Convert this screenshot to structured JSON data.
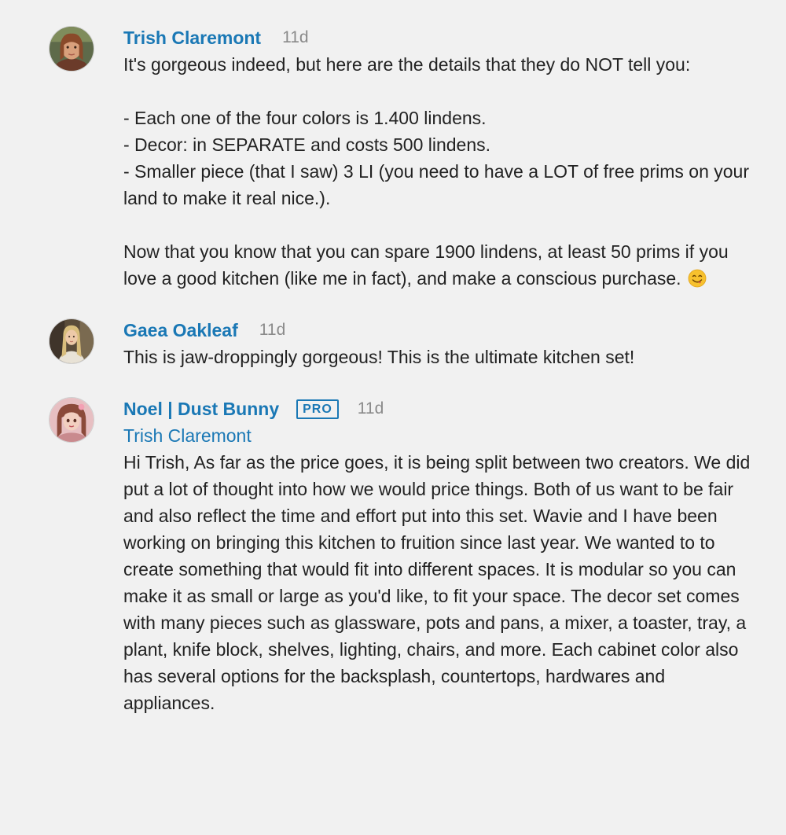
{
  "comments": [
    {
      "author": "Trish Claremont",
      "time": "11d",
      "avatar_icon": "avatar-trish-icon",
      "lines": {
        "p1": "It's gorgeous indeed, but here are the details that they do NOT tell you:",
        "b1": "- Each one of the four colors is 1.400 lindens.",
        "b2": "- Decor: in SEPARATE and costs 500 lindens.",
        "b3": "- Smaller piece (that I saw) 3 LI (you need to have a LOT of free prims on your land to make it real nice.).",
        "p2": "Now that you know that you can spare 1900 lindens, at least 50 prims if you love a good kitchen (like me in fact), and make a conscious purchase."
      },
      "emoji": "face-savoring-food-emoji"
    },
    {
      "author": "Gaea Oakleaf",
      "time": "11d",
      "avatar_icon": "avatar-gaea-icon",
      "text": "This is jaw-droppingly gorgeous! This is the ultimate kitchen set!"
    },
    {
      "author": "Noel | Dust Bunny",
      "badge": "PRO",
      "time": "11d",
      "avatar_icon": "avatar-noel-icon",
      "reply_to": "Trish Claremont",
      "text": "Hi Trish, As far as the price goes, it is being split between two creators. We did put a lot of thought into how we would price things. Both of us want to be fair and also reflect the time and effort put into this set. Wavie and I have been working on bringing this kitchen to fruition since last year. We wanted to to create something that would fit into different spaces. It is modular so you can make it as small or large as you'd like, to fit your space. The decor set comes with many pieces such as glassware, pots and pans, a mixer, a toaster, tray, a plant, knife block, shelves, lighting, chairs, and more. Each cabinet color also has several options for the backsplash, countertops, hardwares and appliances."
    }
  ],
  "colors": {
    "background": "#f1f1f1",
    "link": "#1a78b5",
    "muted": "#8a8a8a",
    "text": "#222222"
  }
}
